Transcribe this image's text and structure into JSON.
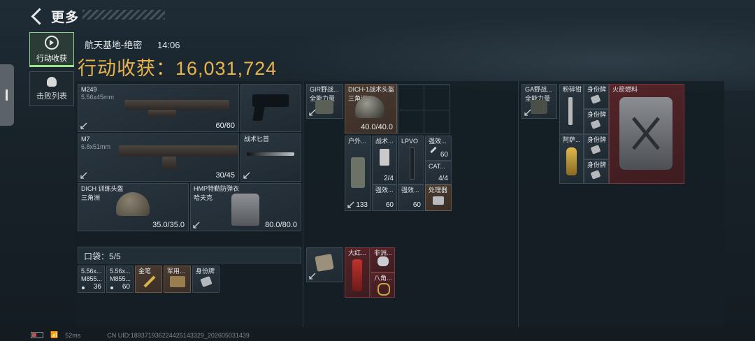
{
  "header": {
    "title": "更多"
  },
  "nav": [
    {
      "label": "行动收获",
      "icon": "play-circle-icon"
    },
    {
      "label": "击败列表",
      "icon": "skull-icon"
    }
  ],
  "map": {
    "name": "航天基地-绝密",
    "time": "14:06"
  },
  "haul": {
    "label": "行动收获：",
    "value": "16,031,724"
  },
  "colors": {
    "accent": "#e9b54a",
    "active_tab": "#9de38e"
  },
  "equipment": {
    "m249": {
      "name": "M249",
      "ammo": "5.56x45mm",
      "value": "60/60"
    },
    "m7": {
      "name": "M7",
      "ammo": "6.8x51mm",
      "value": "30/45"
    },
    "knife": {
      "name": "战术匕首"
    },
    "helmet": {
      "name": "DICH 训练头盔",
      "maker": "三角洲",
      "value": "35.0/35.0"
    },
    "armor": {
      "name": "HMP特勤防弹衣",
      "maker": "哈夫克",
      "value": "80.0/80.0"
    }
  },
  "pocket": {
    "label": "口袋：",
    "count": "5/5",
    "items": [
      {
        "label": "5.56x...",
        "sub": "M855...",
        "count": "36"
      },
      {
        "label": "5.56x...",
        "sub": "M855...",
        "count": "60"
      },
      {
        "label": "金笔"
      },
      {
        "label": "军用..."
      },
      {
        "label": "身份牌"
      }
    ]
  },
  "rig": {
    "vest_label": "GIR野战...",
    "vest_sub": "全能力量",
    "helmet_label": "DICH-1战术头盔",
    "helmet_sub": "三角洲",
    "helmet_value": "40.0/40.0",
    "items": [
      {
        "label": "户外...",
        "count": "133"
      },
      {
        "label": "战术...",
        "count": "2/4"
      },
      {
        "label": "LPVO"
      },
      {
        "label": "强效...",
        "count": "60"
      },
      {
        "label": "CAT...",
        "count": "4/4"
      },
      {
        "label": "强效...",
        "count": "60"
      },
      {
        "label": "强效...",
        "count": "60"
      },
      {
        "label": "处理器"
      }
    ],
    "bottom_items": [
      {
        "label": "大红..."
      },
      {
        "label": "非洲..."
      },
      {
        "label": "八角..."
      }
    ]
  },
  "backpack": {
    "pack_label": "GA野战...",
    "pack_sub": "全能力量",
    "items": [
      {
        "label": "粉碎钳"
      },
      {
        "label": "身份牌"
      },
      {
        "label": "身份牌"
      },
      {
        "label": "阿萨..."
      },
      {
        "label": "身份牌"
      },
      {
        "label": "身份牌"
      },
      {
        "label": "火箭燃料"
      }
    ]
  },
  "footer": {
    "ping": "52ms",
    "uid": "CN UID:18937193622442514332​9_202605031439"
  }
}
